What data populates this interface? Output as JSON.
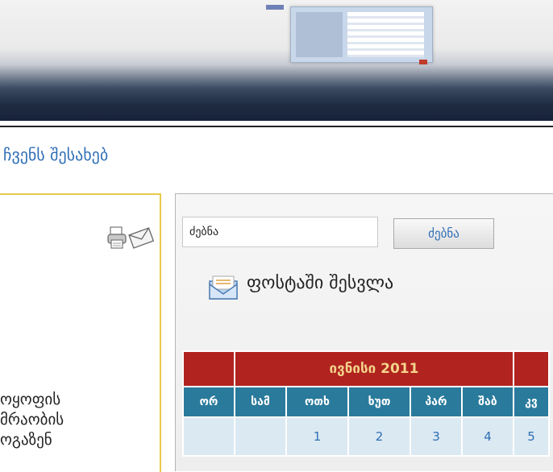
{
  "nav": {
    "about_link": "ჩვენს შესახებ"
  },
  "left": {
    "lines": [
      "ოყოფის",
      "მრაობის",
      "ოგაზენ"
    ]
  },
  "search": {
    "value": "ძებნა",
    "button_label": "ძებნა"
  },
  "mail_login": {
    "label": "ფოსტაში შესვლა"
  },
  "calendar": {
    "month_title": "ივნისი 2011",
    "weekdays": [
      "ორ",
      "სამ",
      "ოთხ",
      "ხუთ",
      "პარ",
      "შაბ",
      "კვ"
    ],
    "first_row": [
      "",
      "",
      "1",
      "2",
      "3",
      "4",
      "5"
    ]
  },
  "colors": {
    "calendar_header": "#b0231f",
    "calendar_month_text": "#f3d38a",
    "calendar_weekday_bg": "#2a7a9c",
    "calendar_date_bg": "#dbe9f2",
    "link_blue": "#2f6eb5",
    "panel_border_yellow": "#e8c84a"
  },
  "icons": [
    "print-icon",
    "mail-icon",
    "envelope-icon"
  ]
}
